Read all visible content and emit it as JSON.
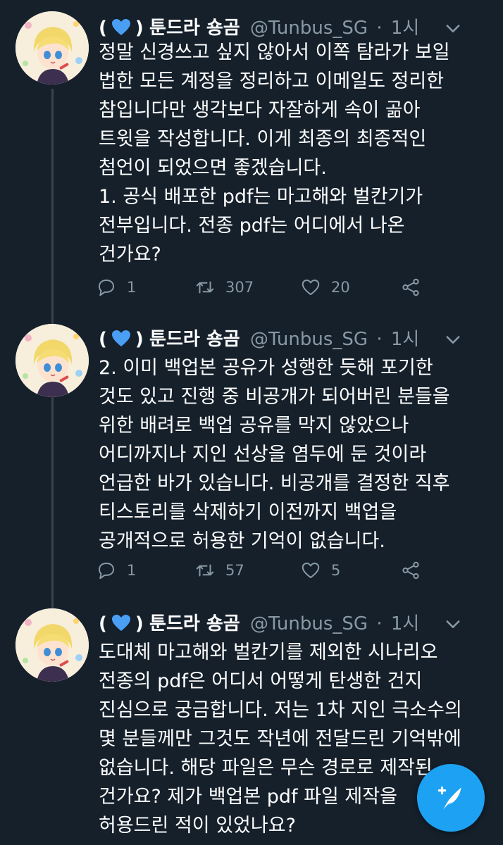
{
  "tweets": [
    {
      "display_name": "(💙) 툰드라 숑곰",
      "paren_open": "(",
      "paren_close": ")",
      "name": "툰드라 숑곰",
      "handle": "@Tunbus_SG",
      "separator": "·",
      "time": "1시",
      "text": "정말 신경쓰고 싶지 않아서 이쪽 탐라가 보일\n법한 모든 계정을 정리하고 이메일도 정리한\n참입니다만 생각보다 자잘하게 속이 곪아\n트윗을 작성합니다. 이게 최종의 최종적인\n첨언이 되었으면 좋겠습니다.\n1. 공식 배포한 pdf는 마고해와 벌칸기가\n전부입니다. 전종 pdf는 어디에서 나온\n건가요?",
      "replies": "1",
      "retweets": "307",
      "likes": "20"
    },
    {
      "name": "툰드라 숑곰",
      "paren_open": "(",
      "paren_close": ")",
      "handle": "@Tunbus_SG",
      "separator": "·",
      "time": "1시",
      "text": "2. 이미 백업본 공유가 성행한 듯해 포기한\n것도 있고 진행 중 비공개가 되어버린 분들을\n위한 배려로 백업 공유를 막지 않았으나\n어디까지나 지인 선상을 염두에 둔 것이라\n언급한 바가 있습니다. 비공개를 결정한 직후\n티스토리를 삭제하기 이전까지 백업을\n공개적으로 허용한 기억이 없습니다.",
      "replies": "1",
      "retweets": "57",
      "likes": "5"
    },
    {
      "name": "툰드라 숑곰",
      "paren_open": "(",
      "paren_close": ")",
      "handle": "@Tunbus_SG",
      "separator": "·",
      "time": "1시",
      "text": "도대체 마고해와 벌칸기를 제외한 시나리오\n전종의 pdf은 어디서 어떻게 탄생한 건지\n진심으로 궁금합니다. 저는 1차 지인 극소수의\n몇 분들께만 그것도 작년에 전달드린 기억밖에\n없습니다. 해당 파일은 무슨 경로로 제작된\n건가요? 제가 백업본 pdf 파일 제작을\n허용드린 적이 있었나요?"
    }
  ],
  "colors": {
    "background": "#15202b",
    "text": "#ffffff",
    "muted": "#8899a6",
    "accent": "#1da1f2",
    "divider": "#38444d",
    "heart_badge": "#4a9ff5"
  },
  "icons": [
    "reply-icon",
    "retweet-icon",
    "like-icon",
    "share-icon",
    "caret-down-icon",
    "compose-tweet-icon",
    "blue-heart-icon"
  ]
}
